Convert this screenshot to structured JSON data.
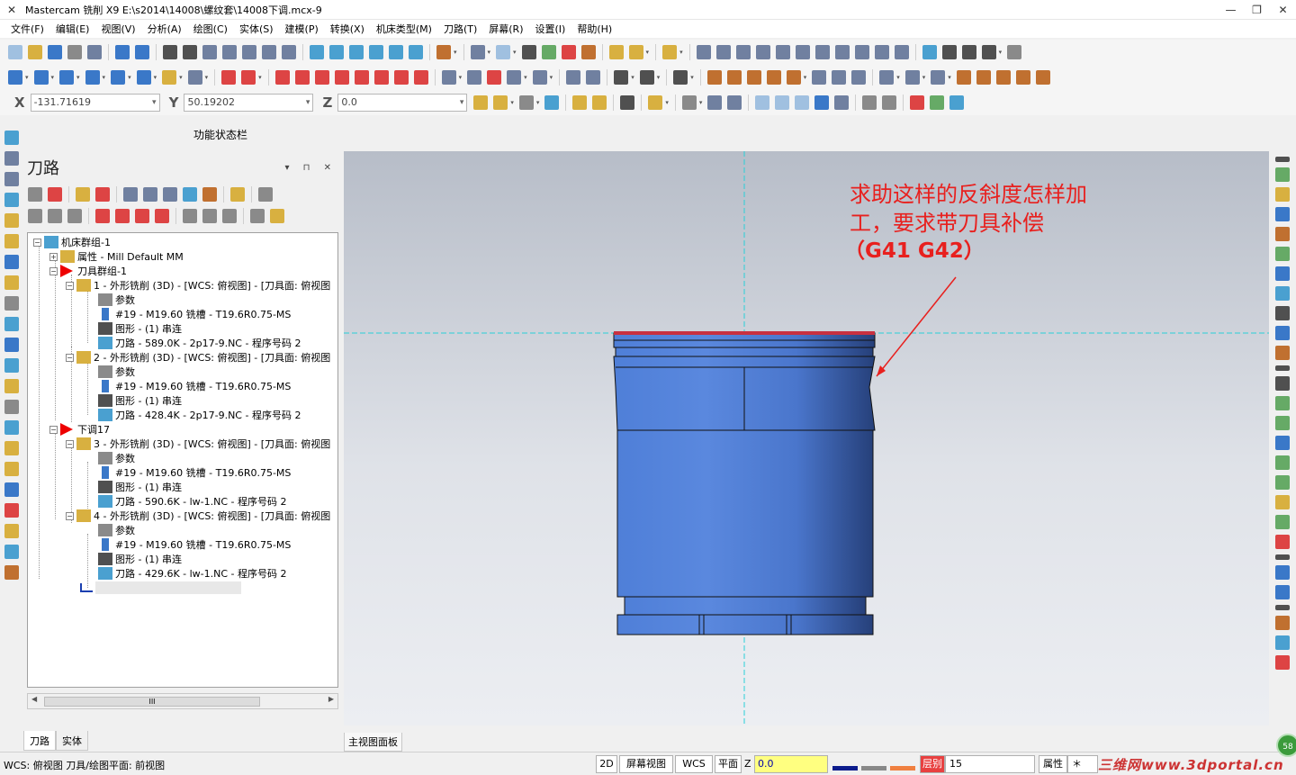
{
  "app": {
    "title": "Mastercam 铣削 X9  E:\\s2014\\14008\\螺纹套\\14008下调.mcx-9",
    "window_controls": [
      "—",
      "❐",
      "✕"
    ]
  },
  "menu": [
    "文件(F)",
    "编辑(E)",
    "视图(V)",
    "分析(A)",
    "绘图(C)",
    "实体(S)",
    "建模(P)",
    "转换(X)",
    "机床类型(M)",
    "刀路(T)",
    "屏幕(R)",
    "设置(I)",
    "帮助(H)"
  ],
  "coords": {
    "x_label": "X",
    "x_value": "-131.71619",
    "y_label": "Y",
    "y_value": "50.19202",
    "z_label": "Z",
    "z_value": "0.0"
  },
  "function_state": "功能状态栏",
  "panel": {
    "title": "刀路",
    "controls": "▾ ⊓ ✕",
    "tree": [
      {
        "label": "机床群组-1"
      },
      {
        "label": "属性 - Mill Default MM"
      },
      {
        "label": "刀具群组-1"
      },
      {
        "label": "1 - 外形铣削 (3D) - [WCS: 俯视图] - [刀具面: 俯视图"
      },
      {
        "label": "参数"
      },
      {
        "label": "#19 - M19.60 铣槽 - T19.6R0.75-MS"
      },
      {
        "label": "图形 - (1) 串连"
      },
      {
        "label": "刀路 - 589.0K - 2p17-9.NC - 程序号码 2"
      },
      {
        "label": "2 - 外形铣削 (3D) - [WCS: 俯视图] - [刀具面: 俯视图"
      },
      {
        "label": "参数"
      },
      {
        "label": "#19 - M19.60 铣槽 - T19.6R0.75-MS"
      },
      {
        "label": "图形 - (1) 串连"
      },
      {
        "label": "刀路 - 428.4K - 2p17-9.NC - 程序号码 2"
      },
      {
        "label": "下调17"
      },
      {
        "label": "3 - 外形铣削 (3D) - [WCS: 俯视图] - [刀具面: 俯视图"
      },
      {
        "label": "参数"
      },
      {
        "label": "#19 - M19.60 铣槽 - T19.6R0.75-MS"
      },
      {
        "label": "图形 - (1) 串连"
      },
      {
        "label": "刀路 - 590.6K - lw-1.NC - 程序号码 2"
      },
      {
        "label": "4 - 外形铣削 (3D) - [WCS: 俯视图] - [刀具面: 俯视图"
      },
      {
        "label": "参数"
      },
      {
        "label": "#19 - M19.60 铣槽 - T19.6R0.75-MS"
      },
      {
        "label": "图形 - (1) 串连"
      },
      {
        "label": "刀路 - 429.6K - lw-1.NC - 程序号码 2"
      }
    ],
    "scroll_thumb": "III",
    "tabs": [
      "刀路",
      "实体"
    ]
  },
  "viewport": {
    "annotation_line1": "求助这样的反斜度怎样加",
    "annotation_line2": "工，要求带刀具补偿",
    "annotation_line3": "（G41  G42）",
    "annotation_color": "#e8201e",
    "part_color": "#4a78d0",
    "tab": "主视图面板"
  },
  "status": {
    "wcs": "WCS: 俯视图  刀具/绘图平面: 前视图",
    "mode_2d": "2D",
    "screen_view": "屏幕视图",
    "wcs_btn": "WCS",
    "plane": "平面",
    "z_label": "Z",
    "z_value": "0.0",
    "level_label": "层别",
    "level_value": "15",
    "attr_label": "属性",
    "attr_value": "＊",
    "watermark": "三维网www.3dportal.cn",
    "badge": "58"
  }
}
